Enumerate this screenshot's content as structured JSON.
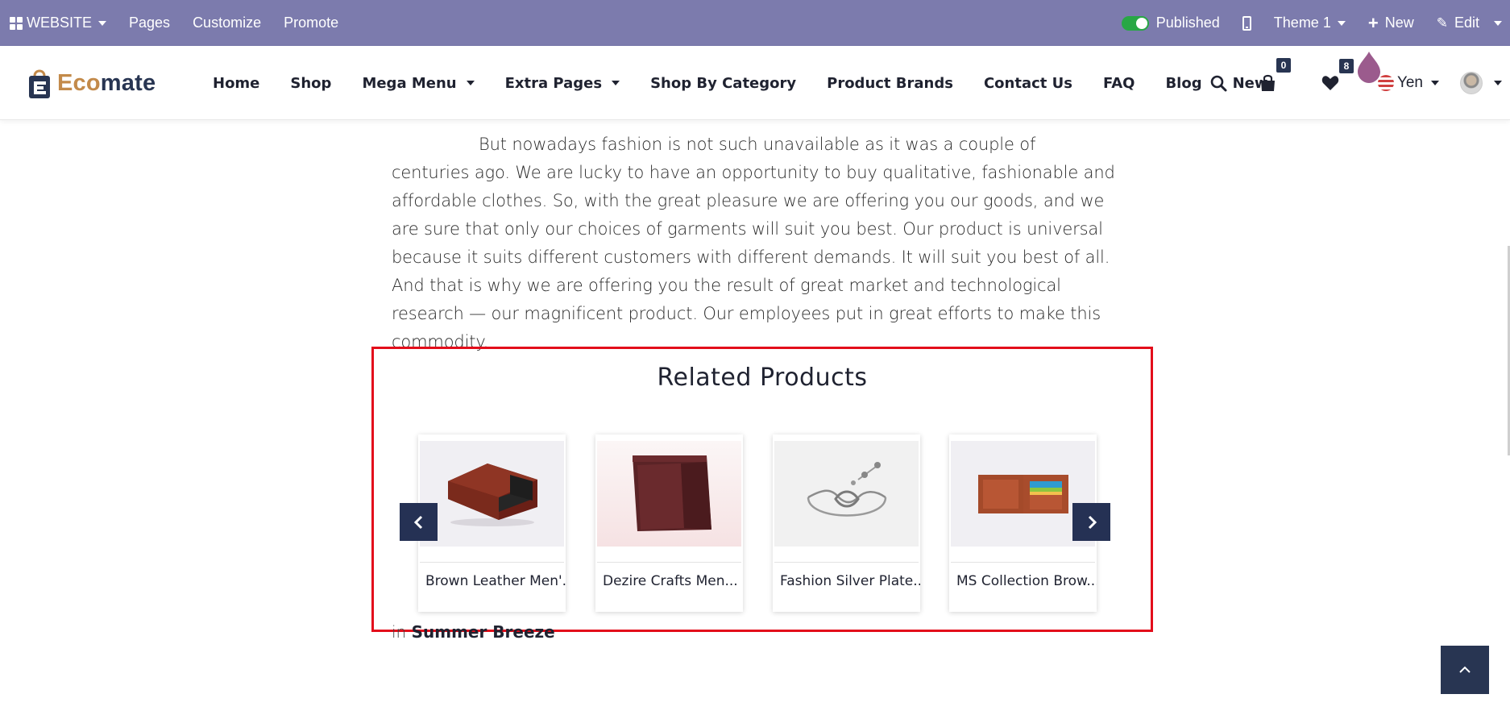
{
  "admin_bar": {
    "website_label": "WEBSITE",
    "pages_label": "Pages",
    "customize_label": "Customize",
    "promote_label": "Promote",
    "published_label": "Published",
    "theme_label": "Theme 1",
    "new_label": "New",
    "edit_label": "Edit"
  },
  "brand": {
    "logo_part1": "Eco",
    "logo_part2": "mate"
  },
  "nav": {
    "items": [
      {
        "label": "Home"
      },
      {
        "label": "Shop"
      },
      {
        "label": "Mega Menu"
      },
      {
        "label": "Extra Pages"
      },
      {
        "label": "Shop By Category"
      },
      {
        "label": "Product Brands"
      },
      {
        "label": "Contact Us"
      },
      {
        "label": "FAQ"
      },
      {
        "label": "Blog"
      },
      {
        "label": "New"
      }
    ],
    "cart_count": "0",
    "wishlist_count": "8",
    "currency": "Yen"
  },
  "content": {
    "paragraph": "But nowadays fashion is not such unavailable as it was a couple of centuries ago. We are lucky to have an opportunity to buy qualitative, fashionable and affordable clothes. So, with the great pleasure we are offering you our goods, and we are sure that only our choices of garments will suit you best. Our product is universal because it suits different customers with different demands. It will suit you best of all. And that is why we are offering you the result of great market and technological research — our magnificent product. Our employees put in great efforts to make this commodity.",
    "related_title": "Related Products",
    "products": [
      {
        "name": "Brown Leather Men'..."
      },
      {
        "name": "Dezire Crafts Men..."
      },
      {
        "name": "Fashion Silver Plate..."
      },
      {
        "name": "MS Collection Brow..."
      }
    ],
    "tag_prefix": "in",
    "tag_name": "Summer Breeze"
  },
  "colors": {
    "admin_bar": "#7c7bad",
    "navy": "#283552",
    "logo_accent": "#c38a4a",
    "highlight_border": "#e30d1b",
    "toggle_on": "#28a745"
  },
  "icons": [
    "apps-grid-icon",
    "caret-down-icon",
    "mobile-icon",
    "plus-icon",
    "pencil-icon",
    "search-icon",
    "shopping-bag-icon",
    "heart-icon",
    "flag-icon",
    "chevron-left-icon",
    "chevron-right-icon",
    "chevron-up-icon"
  ]
}
